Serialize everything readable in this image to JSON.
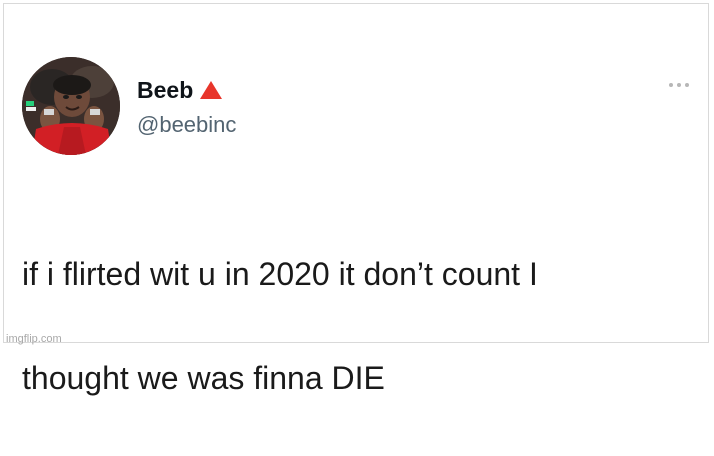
{
  "tweet": {
    "display_name": "Beeb",
    "handle": "@beebinc",
    "badge_icon": "red-triangle-icon",
    "badge_color": "#e8352b",
    "text_line1": "if i flirted wit u in 2020 it don’t count I",
    "text_line2": "thought we was finna DIE",
    "more_icon": "more-options-icon"
  },
  "watermark": "imgflip.com"
}
